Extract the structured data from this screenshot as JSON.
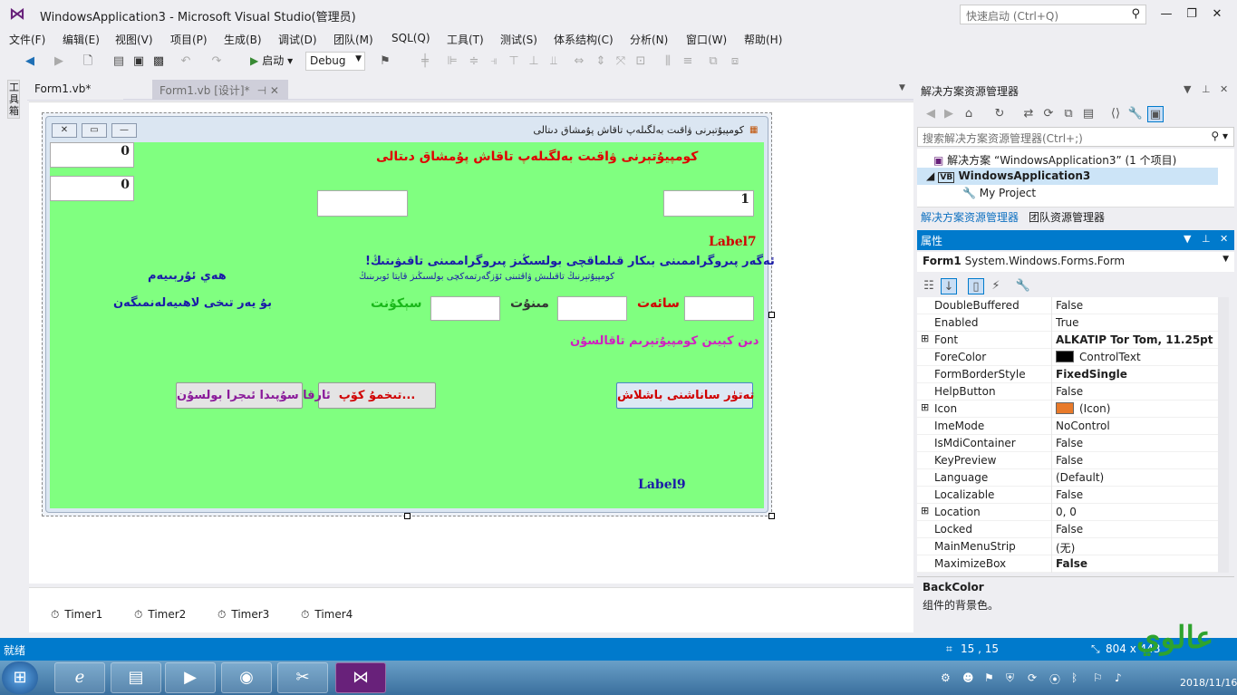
{
  "window": {
    "title": "WindowsApplication3 - Microsoft Visual Studio(管理员)",
    "quick_launch_placeholder": "快速启动 (Ctrl+Q)"
  },
  "menu": [
    "文件(F)",
    "编辑(E)",
    "视图(V)",
    "项目(P)",
    "生成(B)",
    "调试(D)",
    "团队(M)",
    "SQL(Q)",
    "工具(T)",
    "测试(S)",
    "体系结构(C)",
    "分析(N)",
    "窗口(W)",
    "帮助(H)"
  ],
  "toolbar": {
    "start_label": "启动",
    "config_value": "Debug"
  },
  "side_toolbox": {
    "label": "工具箱"
  },
  "tabs": [
    {
      "label": "Form1.vb*"
    },
    {
      "label": "Form1.vb [设计]*"
    }
  ],
  "form": {
    "caption": "كومپيۇتېرنى ۋاقىت بەلگىلەپ تاقاش پۇمشاق دىتالى",
    "heading": "كومپيۇتېرنى ۋاقىت بەلگىلەپ تاقاش پۇمشاق دىتالى",
    "box_top_left": "0",
    "box_left_2": "0",
    "box_right": "1",
    "label7": "Label7",
    "warning": "ئەگەر پىروگراممىنى بىكار قىلماقچى بولسىڭىز پىروگراممىنى تاقىۋىتىڭ!",
    "subnote": "كومپيۇتېرنىڭ تاقىلىش ۋاقتىنى ئۆزگەرتمەكچى بولسىڭىز قايتا ئوبرىنىڭ",
    "right_note_1": "ھەي ئۇربىيەم",
    "right_note_2": "بۇ يەر تىخى لاھىيەلەنمىگەن",
    "hour_label": "سائەت",
    "minute_label": "مىنۇت",
    "second_label": "سېكۇنت",
    "shutdown_msg": "دىن كېيىن كومپيۇتېرىم تاقالسۇن",
    "btn_set": "تەتۈر ساناشنى باشلاش",
    "btn_pick": "تىخمۇ كۆپ...",
    "btn_other": "ئارقا سۇپىدا ئىجرا بولسۇن",
    "label9": "Label9"
  },
  "tray_components": [
    "Timer1",
    "Timer2",
    "Timer3",
    "Timer4"
  ],
  "solution_explorer": {
    "title": "解决方案资源管理器",
    "search_placeholder": "搜索解决方案资源管理器(Ctrl+;)",
    "solution_label": "解决方案 “WindowsApplication3” (1 个项目)",
    "project_label": "WindowsApplication3",
    "my_project_label": "My Project",
    "tab_solution": "解决方案资源管理器",
    "tab_team": "团队资源管理器"
  },
  "properties": {
    "title": "属性",
    "object_name": "Form1",
    "object_type": "System.Windows.Forms.Form",
    "rows": [
      {
        "name": "DoubleBuffered",
        "value": "False",
        "bold": false,
        "expand": false
      },
      {
        "name": "Enabled",
        "value": "True",
        "bold": false,
        "expand": false
      },
      {
        "name": "Font",
        "value": "ALKATIP Tor Tom, 11.25pt",
        "bold": true,
        "expand": true
      },
      {
        "name": "ForeColor",
        "value": "ControlText",
        "bold": false,
        "expand": false,
        "swatch": "#000000"
      },
      {
        "name": "FormBorderStyle",
        "value": "FixedSingle",
        "bold": true,
        "expand": false
      },
      {
        "name": "HelpButton",
        "value": "False",
        "bold": false,
        "expand": false
      },
      {
        "name": "Icon",
        "value": "(Icon)",
        "bold": false,
        "expand": true,
        "swatch": "#e87a2a"
      },
      {
        "name": "ImeMode",
        "value": "NoControl",
        "bold": false,
        "expand": false
      },
      {
        "name": "IsMdiContainer",
        "value": "False",
        "bold": false,
        "expand": false
      },
      {
        "name": "KeyPreview",
        "value": "False",
        "bold": false,
        "expand": false
      },
      {
        "name": "Language",
        "value": "(Default)",
        "bold": false,
        "expand": false
      },
      {
        "name": "Localizable",
        "value": "False",
        "bold": false,
        "expand": false
      },
      {
        "name": "Location",
        "value": "0, 0",
        "bold": false,
        "expand": true
      },
      {
        "name": "Locked",
        "value": "False",
        "bold": false,
        "expand": false
      },
      {
        "name": "MainMenuStrip",
        "value": "(无)",
        "bold": false,
        "expand": false
      },
      {
        "name": "MaximizeBox",
        "value": "False",
        "bold": true,
        "expand": false
      }
    ],
    "desc_title": "BackColor",
    "desc_text": "组件的背景色。"
  },
  "status": {
    "left": "就绪",
    "position": "15 , 15",
    "size": "804 x 443"
  },
  "clock": {
    "date": "2018/11/16"
  },
  "colors": {
    "accent": "#007acc",
    "form_bg": "#80ff80"
  }
}
